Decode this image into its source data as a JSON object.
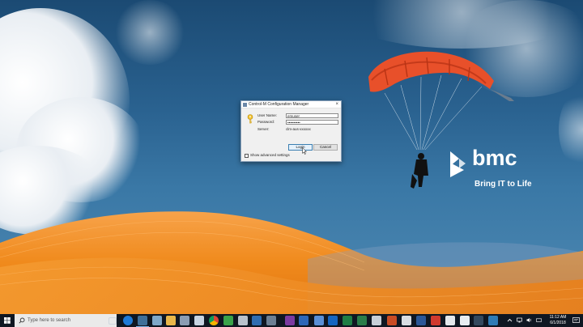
{
  "dialog": {
    "title": "Control-M Configuration Manager",
    "close_glyph": "×",
    "username_label": "User Name:",
    "username_value": "emuser",
    "password_label": "Password:",
    "password_value": "••••••••••",
    "server_label": "Server:",
    "server_value": "clm-aus-xxxxxx",
    "login_label": "Login",
    "cancel_label": "Cancel",
    "advanced_label": "Show advanced settings",
    "advanced_checked": false
  },
  "brand": {
    "name": "bmc",
    "tagline": "Bring IT to Life"
  },
  "taskbar": {
    "search_placeholder": "Type here to search",
    "apps": [
      {
        "icon": "task-view-icon"
      },
      {
        "icon": "edge-icon"
      },
      {
        "icon": "file-explorer-icon"
      },
      {
        "icon": "control-m-icon",
        "active": true
      },
      {
        "icon": "app-icon"
      },
      {
        "icon": "app-icon"
      },
      {
        "icon": "app-icon"
      },
      {
        "icon": "chrome-icon"
      },
      {
        "icon": "app-icon"
      },
      {
        "icon": "app-icon"
      },
      {
        "icon": "app-icon"
      },
      {
        "icon": "app-icon"
      },
      {
        "icon": "app-icon"
      },
      {
        "icon": "app-icon"
      },
      {
        "icon": "onenote-icon"
      },
      {
        "icon": "outlook-icon"
      },
      {
        "icon": "app-icon"
      },
      {
        "icon": "excel-icon"
      },
      {
        "icon": "app-icon"
      },
      {
        "icon": "powerpoint-icon"
      },
      {
        "icon": "app-icon"
      },
      {
        "icon": "word-icon"
      },
      {
        "icon": "app-icon"
      },
      {
        "icon": "app-icon"
      },
      {
        "icon": "app-icon"
      },
      {
        "icon": "app-icon"
      },
      {
        "icon": "app-icon"
      }
    ],
    "clock_time": "11:12 AM",
    "clock_date": "6/1/2018"
  },
  "colors": {
    "taskbar_bg": "#0f1722",
    "accent": "#3c7fb1",
    "dune_orange": "#f08a1c",
    "chute_red": "#e8502a"
  }
}
